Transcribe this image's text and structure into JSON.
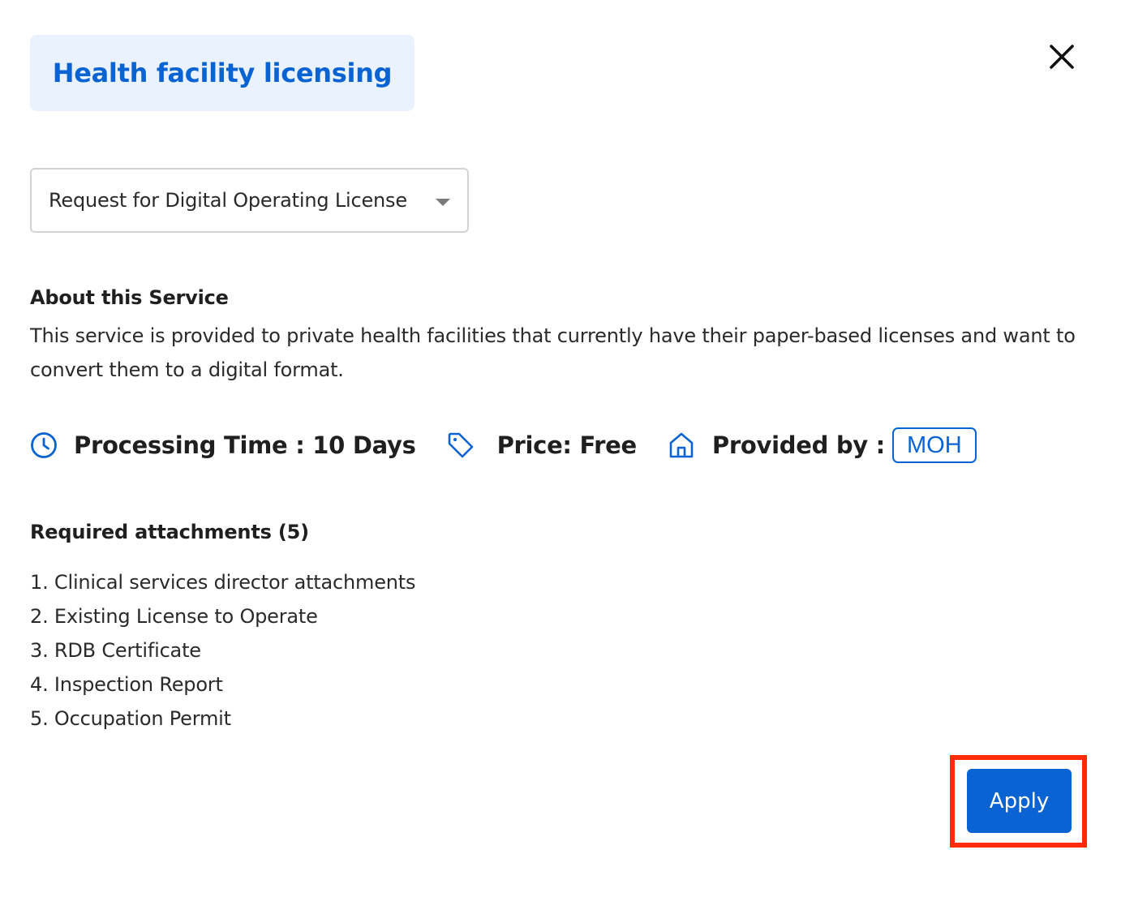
{
  "header": {
    "title": "Health facility licensing",
    "close_icon": "close-icon"
  },
  "service_select": {
    "selected": "Request for Digital Operating License",
    "icon": "chevron-down-icon"
  },
  "about": {
    "title": "About this Service",
    "description": "This service is provided to private health facilities that currently have their paper-based licenses and want to convert them to a digital format."
  },
  "meta": {
    "processing_time": "Processing Time : 10 Days",
    "price": "Price: Free",
    "provided_by_label": "Provided by :",
    "provider": "MOH",
    "icons": [
      "clock-icon",
      "tag-icon",
      "home-icon"
    ]
  },
  "attachments": {
    "title": "Required attachments (5)",
    "items": [
      "1. Clinical services director attachments",
      "2. Existing License to Operate",
      "3. RDB Certificate",
      "4. Inspection Report",
      "5. Occupation Permit"
    ]
  },
  "actions": {
    "apply_label": "Apply"
  },
  "colors": {
    "accent": "#0a63d3",
    "chip_background": "#eaf3fd",
    "highlight": "#ff2a00"
  }
}
